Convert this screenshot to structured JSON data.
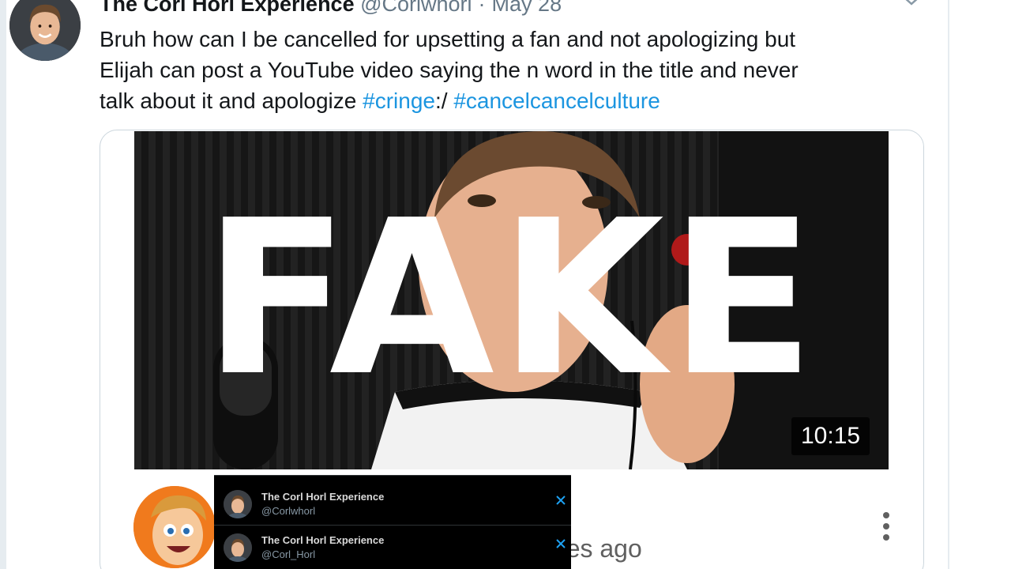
{
  "tweet": {
    "display_name": "The Corl Horl Experience",
    "handle": "@Corlwhorl",
    "separator": "·",
    "date": "May 28",
    "text_lines": [
      "Bruh how can I be cancelled for upsetting a fan and not apologizing but",
      "Elijah can post a YouTube video saying the n word in the title and never"
    ],
    "text_line3_plain": "talk about it and apologize ",
    "hashtag_1": "#cringe",
    "text_between": ":/ ",
    "hashtag_2": "#cancelcancelculture",
    "avatar_icon": "user-avatar-icon",
    "caret_icon": "chevron-down-icon",
    "hashtag_color": "#1b95e0"
  },
  "video_card": {
    "stamp": "FAKE",
    "duration": "10:15",
    "time_ago": "utes ago",
    "channel_avatar_icon": "cartoon-avatar-icon",
    "more_icon": "more-vertical-icon"
  },
  "account_switcher": {
    "accounts": [
      {
        "name": "The Corl Horl Experience",
        "handle": "@Corlwhorl"
      },
      {
        "name": "The Corl Horl Experience",
        "handle": "@Corl_Horl"
      }
    ],
    "remove_icon": "close-icon",
    "remove_color": "#1da1f2"
  }
}
